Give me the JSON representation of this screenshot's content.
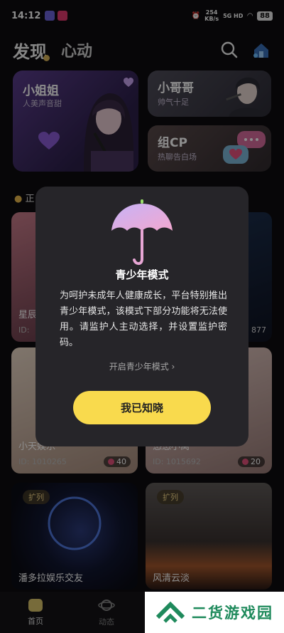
{
  "status_bar": {
    "time": "14:12",
    "net_speed_top": "254",
    "net_speed_bottom": "KB/s",
    "signal": "5G HD",
    "battery": "88"
  },
  "header": {
    "tab_discover": "发现",
    "tab_heartbeat": "心动",
    "icons": [
      "search-icon",
      "house-icon"
    ]
  },
  "cards": {
    "girl": {
      "title": "小姐姐",
      "subtitle": "人美声音甜"
    },
    "guy": {
      "title": "小哥哥",
      "subtitle": "帅气十足"
    },
    "cp": {
      "title": "组CP",
      "subtitle": "热聊告白场"
    }
  },
  "section": {
    "label": "正"
  },
  "rooms": [
    {
      "name": "星辰",
      "id": "ID:",
      "count": ""
    },
    {
      "name": "",
      "id": "",
      "count": "877"
    },
    {
      "badge": "",
      "name": "小天娱乐",
      "id": "ID: 1010265",
      "count": "40"
    },
    {
      "badge": "",
      "name": "悠悠小窝",
      "id": "ID: 1015692",
      "count": "20"
    },
    {
      "badge": "扩列",
      "name": "潘多拉娱乐交友",
      "id": "",
      "count": ""
    },
    {
      "badge": "扩列",
      "name": "风清云淡",
      "id": "",
      "count": ""
    }
  ],
  "modal": {
    "title": "青少年模式",
    "body": "为呵护未成年人健康成长，平台特别推出青少年模式，该模式下部分功能将无法使用。请监护人主动选择，并设置监护密码。",
    "link": "开启青少年模式 ›",
    "button": "我已知晓"
  },
  "bottom_nav": [
    {
      "label": "首页",
      "icon": "home-icon"
    },
    {
      "label": "动态",
      "icon": "planet-icon"
    }
  ],
  "watermark": {
    "text": "二货游戏园"
  },
  "colors": {
    "accent_yellow": "#f9da4d",
    "modal_bg": "#262529",
    "watermark_green": "#1f8a5c"
  }
}
